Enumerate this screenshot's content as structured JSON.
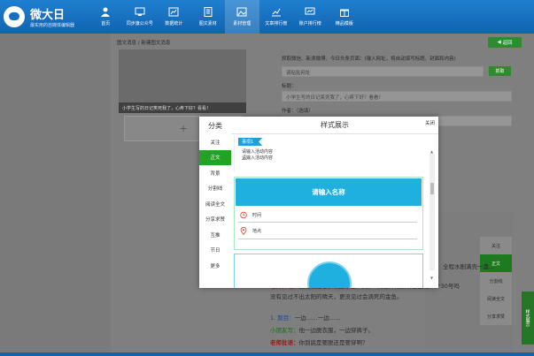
{
  "app": {
    "title": "微大日",
    "subtitle": "最实用的自媒体编辑器"
  },
  "nav": [
    {
      "label": "首页",
      "icon": "home-icon"
    },
    {
      "label": "同步旗公众号",
      "icon": "sync-accounts-icon"
    },
    {
      "label": "数据统计",
      "icon": "stats-icon"
    },
    {
      "label": "图文素材",
      "icon": "article-material-icon"
    },
    {
      "label": "素材管理",
      "icon": "image-manage-icon"
    },
    {
      "label": "文章排行榜",
      "icon": "ranking-chart-icon"
    },
    {
      "label": "账户排行榜",
      "icon": "account-ranking-icon"
    },
    {
      "label": "精品模版",
      "icon": "template-gift-icon"
    }
  ],
  "page": {
    "breadcrumb": "图文消息 / 新建图文消息",
    "back_label": "返回",
    "preview_caption": "小学生写的日记笑死我了，心疼下好？看看！",
    "add_symbol": "+",
    "fetch_hint": "抓取微信、新浪微博、今日头条页面：(输入网址，将自动填写标题、封面和内容)",
    "url_placeholder": "请粘贴网址",
    "fetch_label": "抓取",
    "title_label": "标题：",
    "title_value": "小学生写的日记笑死我了，心疼下好？看看！",
    "author_label": "作者：（选填）",
    "side_menu": [
      "关注",
      "正文",
      "分割线",
      "阅读全文",
      "分享求赞"
    ],
    "side_menu_selected": 1,
    "green_side_label": "样式展示",
    "content_line1_prefix": "",
    "content_line1": "全程水剧满壳一盏...",
    "content_line2a": "老师评语：",
    "content_line2b": "我也很担心，欢迎了这么大，2月还开始没有遇上过一个30号吗",
    "content_line3": "没有见过不出太阳的晴天，更没见过会滴死的金鱼。",
    "content_line4a": "1. 题目：",
    "content_line4b": "一边……一边……",
    "content_line5a": "小朋友写：",
    "content_line5b": "他一边脱衣服，一边穿裤子。",
    "content_line6a": "老师批语：",
    "content_line6b": "你到底是要脱还是要穿啊？"
  },
  "modal": {
    "category_header": "分类",
    "title": "样式展示",
    "close_label": "关闭",
    "categories": [
      "关注",
      "正文",
      "背景",
      "分割线",
      "阅读全文",
      "分享求赞",
      "互推",
      "节日",
      "更多"
    ],
    "active_category": 1,
    "tpl1_tag": "事项1",
    "tpl1_line1": "请输入活动内容",
    "tpl1_line2": "请输入活动内容",
    "tpl2_title": "请输入名称",
    "tpl2_time": "时间",
    "tpl2_place": "地点"
  },
  "colors": {
    "nav_blue": "#1163b0",
    "accent_green": "#23a323",
    "template_cyan": "#1fb0e0"
  }
}
